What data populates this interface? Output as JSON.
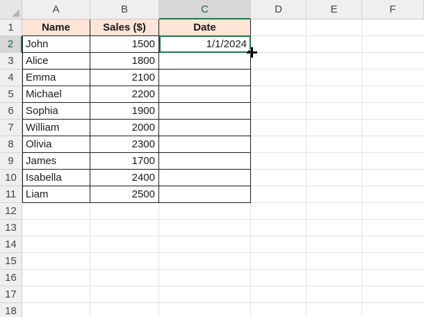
{
  "corner": {
    "icon": "select-all-triangle-icon"
  },
  "column_headers": [
    "A",
    "B",
    "C",
    "D",
    "E",
    "F"
  ],
  "active_column": "C",
  "row_headers": [
    "1",
    "2",
    "3",
    "4",
    "5",
    "6",
    "7",
    "8",
    "9",
    "10",
    "11",
    "12",
    "13",
    "14",
    "15",
    "16",
    "17",
    "18"
  ],
  "active_row": "2",
  "table": {
    "headers": [
      "Name",
      "Sales ($)",
      "Date"
    ],
    "rows": [
      {
        "name": "John",
        "sales": "1500",
        "date": "1/1/2024"
      },
      {
        "name": "Alice",
        "sales": "1800",
        "date": ""
      },
      {
        "name": "Emma",
        "sales": "2100",
        "date": ""
      },
      {
        "name": "Michael",
        "sales": "2200",
        "date": ""
      },
      {
        "name": "Sophia",
        "sales": "1900",
        "date": ""
      },
      {
        "name": "William",
        "sales": "2000",
        "date": ""
      },
      {
        "name": "Olivia",
        "sales": "2300",
        "date": ""
      },
      {
        "name": "James",
        "sales": "1700",
        "date": ""
      },
      {
        "name": "Isabella",
        "sales": "2400",
        "date": ""
      },
      {
        "name": "Liam",
        "sales": "2500",
        "date": ""
      }
    ]
  },
  "selection": {
    "cell": "C2",
    "cursor_icon": "fill-crosshair-cursor-icon"
  },
  "colors": {
    "header_fill": "#fce4d6",
    "selection_green": "#217346",
    "header_bar": "#efefef",
    "gridline": "#e1e1e1",
    "table_border": "#1a1a1a"
  }
}
